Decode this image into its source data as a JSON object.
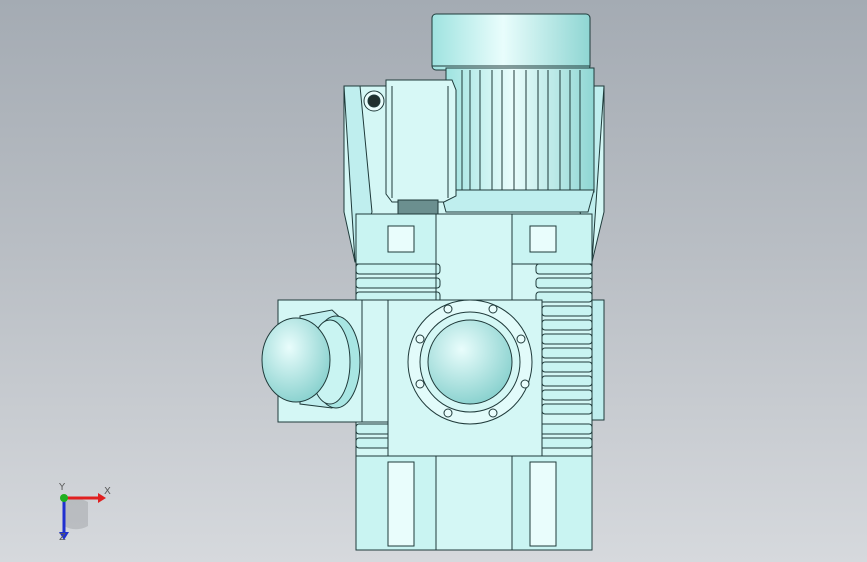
{
  "viewport": {
    "background_top": "#a4abb3",
    "background_bottom": "#d6d9dd",
    "model_fill": "#c9f4f2",
    "model_edge": "#1f3a3a",
    "model_highlight": "#e9fdfc",
    "model_shadow": "#7fc9c6"
  },
  "model": {
    "name": "gear-motor-assembly",
    "components": [
      "motor-fan-cover",
      "motor-housing",
      "terminal-box",
      "gearbox-housing",
      "output-flange",
      "output-shaft-collar"
    ]
  },
  "triad": {
    "x_label": "X",
    "y_label": "Y",
    "z_label": "Z",
    "x_color": "#e02020",
    "y_color": "#20b020",
    "z_color": "#2030d0"
  }
}
